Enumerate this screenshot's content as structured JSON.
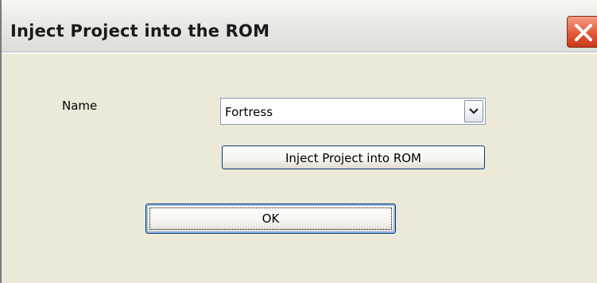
{
  "window": {
    "title": "Inject Project into the ROM"
  },
  "form": {
    "name_label": "Name",
    "name_select": {
      "selected_value": "Fortress"
    }
  },
  "buttons": {
    "inject_label": "Inject Project into ROM",
    "ok_label": "OK"
  },
  "icons": {
    "close": "close-icon",
    "dropdown": "chevron-down-icon"
  },
  "colors": {
    "background": "#ece9d8",
    "close_button": "#e35a3a",
    "button_border": "#003c74"
  }
}
